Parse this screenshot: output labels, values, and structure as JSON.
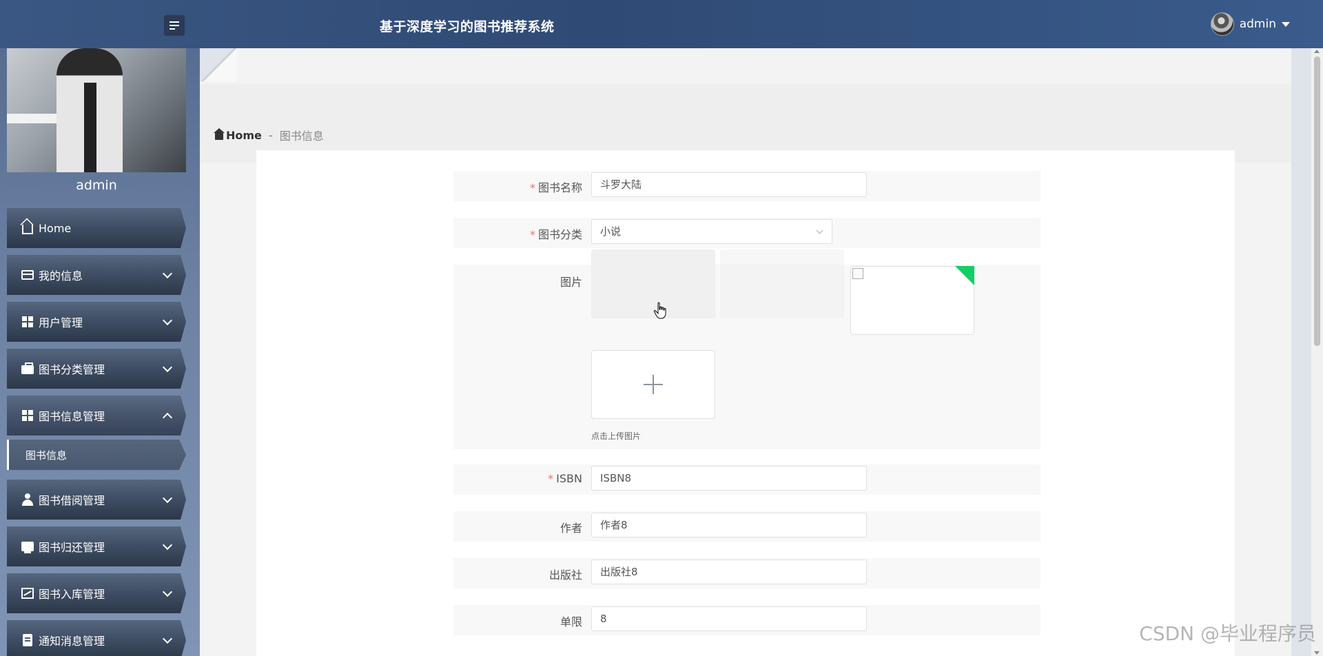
{
  "header": {
    "title": "基于深度学习的图书推荐系统",
    "username": "admin"
  },
  "profile": {
    "name": "admin"
  },
  "sidebar": {
    "items": [
      {
        "label": "Home",
        "icon": "home-icon"
      },
      {
        "label": "我的信息",
        "icon": "card-icon"
      },
      {
        "label": "用户管理",
        "icon": "grid-icon"
      },
      {
        "label": "图书分类管理",
        "icon": "briefcase-icon"
      },
      {
        "label": "图书信息管理",
        "icon": "grid-icon",
        "expanded": true
      },
      {
        "label": "图书借阅管理",
        "icon": "user-icon"
      },
      {
        "label": "图书归还管理",
        "icon": "tray-icon"
      },
      {
        "label": "图书入库管理",
        "icon": "chart-icon"
      },
      {
        "label": "通知消息管理",
        "icon": "clipboard-icon"
      }
    ],
    "sub_item": "图书信息"
  },
  "breadcrumb": {
    "home": "Home",
    "separator": "-",
    "current": "图书信息"
  },
  "form": {
    "name_label": "图书名称",
    "name_value": "斗罗大陆",
    "category_label": "图书分类",
    "category_value": "小说",
    "image_label": "图片",
    "upload_tip": "点击上传图片",
    "isbn_label": "ISBN",
    "isbn_value": "ISBN8",
    "author_label": "作者",
    "author_value": "作者8",
    "publisher_label": "出版社",
    "publisher_value": "出版社8",
    "limit_label": "单限",
    "limit_value": "8",
    "required_mark": "*"
  },
  "watermark": "CSDN @毕业程序员",
  "colors": {
    "topbar": "#34507d",
    "required": "#f56c6c",
    "upload_success": "#13ce66"
  }
}
